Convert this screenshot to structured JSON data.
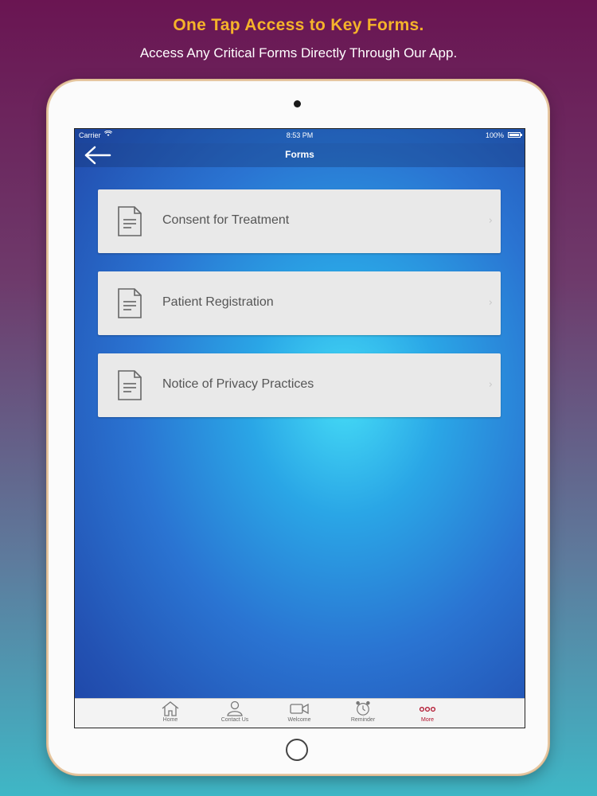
{
  "promo": {
    "title": "One Tap Access to Key Forms.",
    "subtitle": "Access Any Critical Forms Directly Through Our App."
  },
  "status_bar": {
    "carrier": "Carrier",
    "time": "8:53 PM",
    "battery": "100%"
  },
  "nav": {
    "title": "Forms",
    "back_icon": "arrow-left-icon"
  },
  "forms": [
    {
      "label": "Consent for Treatment",
      "icon": "document-icon"
    },
    {
      "label": "Patient Registration",
      "icon": "document-icon"
    },
    {
      "label": "Notice of Privacy Practices",
      "icon": "document-icon"
    }
  ],
  "tabs": [
    {
      "label": "Home",
      "icon": "home-icon"
    },
    {
      "label": "Contact Us",
      "icon": "person-icon"
    },
    {
      "label": "Welcome",
      "icon": "video-camera-icon"
    },
    {
      "label": "Reminder",
      "icon": "alarm-clock-icon"
    },
    {
      "label": "More",
      "icon": "more-dots-icon"
    }
  ],
  "colors": {
    "promo_title": "#f5b32a",
    "active_tab": "#b0102a",
    "row_background": "#e9e9e9"
  }
}
